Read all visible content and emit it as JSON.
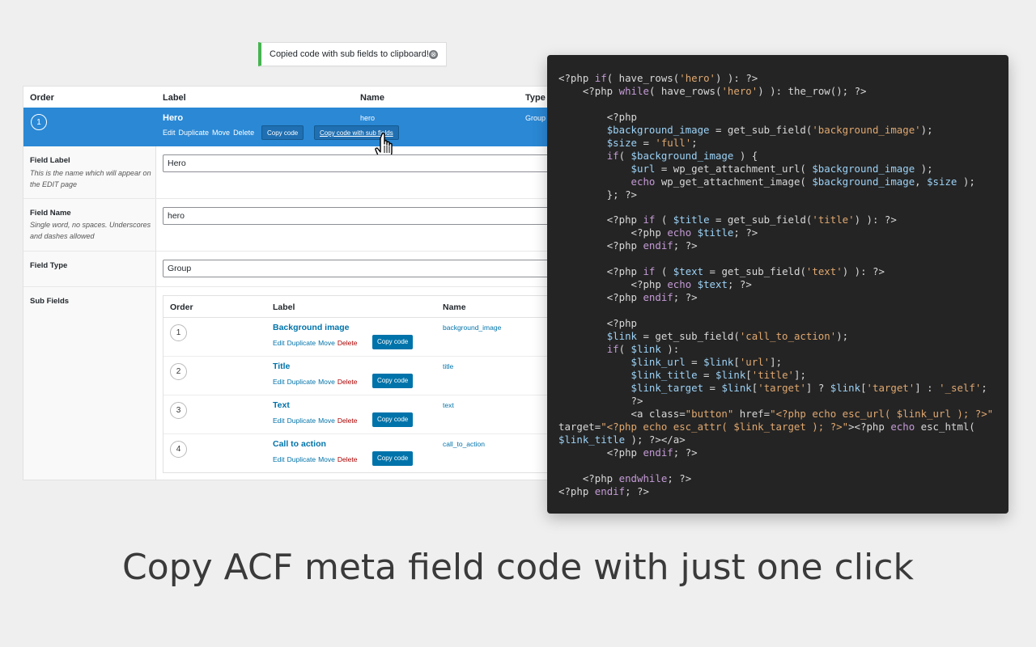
{
  "notice": {
    "text": "Copied code with sub fields to clipboard!",
    "dismiss_icon": "⊗"
  },
  "table": {
    "headers": [
      "Order",
      "Label",
      "Name",
      "Type"
    ],
    "hero": {
      "order": "1",
      "label": "Hero",
      "name": "hero",
      "type": "Group",
      "actions": [
        "Edit",
        "Duplicate",
        "Move",
        "Delete"
      ],
      "copy_code": "Copy code",
      "copy_sub": "Copy code with sub fields"
    }
  },
  "settings": {
    "field_label": {
      "title": "Field Label",
      "desc": "This is the name which will appear on the EDIT page",
      "value": "Hero"
    },
    "field_name": {
      "title": "Field Name",
      "desc": "Single word, no spaces. Underscores and dashes allowed",
      "value": "hero"
    },
    "field_type": {
      "title": "Field Type",
      "value": "Group"
    },
    "sub_fields": {
      "title": "Sub Fields"
    }
  },
  "subfields": {
    "headers": [
      "Order",
      "Label",
      "Name"
    ],
    "rows": [
      {
        "order": "1",
        "label": "Background image",
        "name": "background_image",
        "actions": [
          "Edit",
          "Duplicate",
          "Move",
          "Delete"
        ],
        "copy": "Copy code"
      },
      {
        "order": "2",
        "label": "Title",
        "name": "title",
        "actions": [
          "Edit",
          "Duplicate",
          "Move",
          "Delete"
        ],
        "copy": "Copy code"
      },
      {
        "order": "3",
        "label": "Text",
        "name": "text",
        "actions": [
          "Edit",
          "Duplicate",
          "Move",
          "Delete"
        ],
        "copy": "Copy code"
      },
      {
        "order": "4",
        "label": "Call to action",
        "name": "call_to_action",
        "actions": [
          "Edit",
          "Duplicate",
          "Move",
          "Delete"
        ],
        "copy": "Copy code"
      }
    ]
  },
  "code_lines": [
    "<?php if( have_rows('hero') ): ?>",
    "    <?php while( have_rows('hero') ): the_row(); ?>",
    "",
    "        <?php",
    "        $background_image = get_sub_field('background_image');",
    "        $size = 'full';",
    "        if( $background_image ) {",
    "            $url = wp_get_attachment_url( $background_image );",
    "            echo wp_get_attachment_image( $background_image, $size );",
    "        }; ?>",
    "",
    "        <?php if ( $title = get_sub_field('title') ): ?>",
    "            <?php echo $title; ?>",
    "        <?php endif; ?>",
    "",
    "        <?php if ( $text = get_sub_field('text') ): ?>",
    "            <?php echo $text; ?>",
    "        <?php endif; ?>",
    "",
    "        <?php",
    "        $link = get_sub_field('call_to_action');",
    "        if( $link ):",
    "            $link_url = $link['url'];",
    "            $link_title = $link['title'];",
    "            $link_target = $link['target'] ? $link['target'] : '_self';",
    "            ?>",
    "            <a class=\"button\" href=\"<?php echo esc_url( $link_url ); ?>\"",
    "target=\"<?php echo esc_attr( $link_target ); ?>\"><?php echo esc_html(",
    "$link_title ); ?></a>",
    "        <?php endif; ?>",
    "",
    "    <?php endwhile; ?>",
    "<?php endif; ?>"
  ],
  "caption": "Copy ACF meta field code with just one click",
  "colors": {
    "accent": "#2a88d5",
    "button": "#0073aa",
    "notice_border": "#46b450",
    "code_bg": "#242424"
  }
}
